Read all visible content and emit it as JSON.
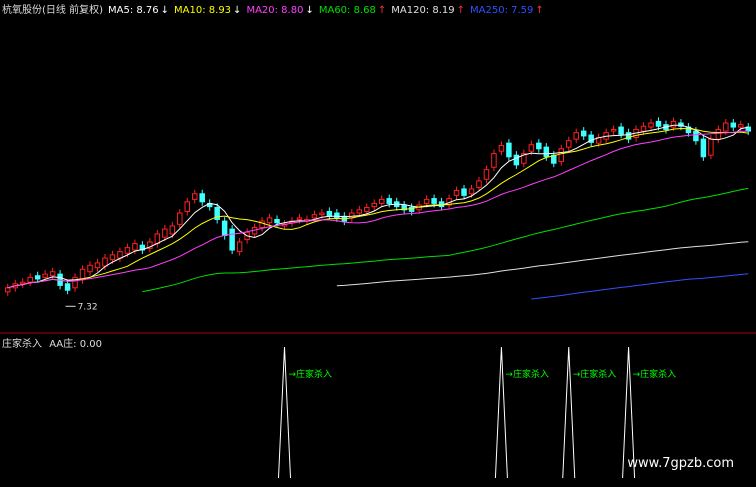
{
  "header": {
    "title": "杭氧股份(日线 前复权)",
    "indicators": [
      {
        "label": "MA5: 8.76",
        "arrow": "↓",
        "color": "#ffffff",
        "arrow_color": "#ffffff"
      },
      {
        "label": "MA10: 8.93",
        "arrow": "↓",
        "color": "#ffff00",
        "arrow_color": "#ffffff"
      },
      {
        "label": "MA20: 8.80",
        "arrow": "↓",
        "color": "#ff40ff",
        "arrow_color": "#ffffff"
      },
      {
        "label": "MA60: 8.68",
        "arrow": "↑",
        "color": "#00e000",
        "arrow_color": "#ff3030"
      },
      {
        "label": "MA120: 8.19",
        "arrow": "↑",
        "color": "#e0e0e0",
        "arrow_color": "#ff3030"
      },
      {
        "label": "MA250: 7.59",
        "arrow": "↑",
        "color": "#3050ff",
        "arrow_color": "#ff3030"
      }
    ]
  },
  "subpanel": {
    "title": "庄家杀入",
    "indicator": "AA庄: 0.00",
    "signal_label": "庄家杀入"
  },
  "annotations": {
    "low_marker": "7.32"
  },
  "watermark": "www.7gpzb.com",
  "colors": {
    "up": "#ff2020",
    "down": "#40ffff",
    "ma5": "#ffffff",
    "ma10": "#ffff00",
    "ma20": "#ff40ff",
    "ma60": "#00e000",
    "ma120": "#e0e0e0",
    "ma250": "#3050ff",
    "signal": "#ffffff",
    "signal_text": "#00ff00",
    "divider": "#b00000"
  },
  "chart_data": [
    {
      "type": "candlestick",
      "title": "杭氧股份(日线 前复权)",
      "ylim": [
        7.0,
        9.7
      ],
      "x": [
        1,
        2,
        3,
        4,
        5,
        6,
        7,
        8,
        9,
        10,
        11,
        12,
        13,
        14,
        15,
        16,
        17,
        18,
        19,
        20,
        21,
        22,
        23,
        24,
        25,
        26,
        27,
        28,
        29,
        30,
        31,
        32,
        33,
        34,
        35,
        36,
        37,
        38,
        39,
        40,
        41,
        42,
        43,
        44,
        45,
        46,
        47,
        48,
        49,
        50,
        51,
        52,
        53,
        54,
        55,
        56,
        57,
        58,
        59,
        60,
        61,
        62,
        63,
        64,
        65,
        66,
        67,
        68,
        69,
        70,
        71,
        72,
        73,
        74,
        75,
        76,
        77,
        78,
        79,
        80,
        81,
        82,
        83,
        84,
        85,
        86,
        87,
        88,
        89,
        90,
        91,
        92,
        93,
        94,
        95,
        96,
        97,
        98,
        99,
        100
      ],
      "open": [
        7.5,
        7.55,
        7.6,
        7.62,
        7.7,
        7.68,
        7.7,
        7.72,
        7.6,
        7.55,
        7.65,
        7.75,
        7.8,
        7.82,
        7.9,
        7.92,
        7.98,
        8.02,
        8.08,
        8.04,
        8.1,
        8.18,
        8.22,
        8.34,
        8.5,
        8.65,
        8.72,
        8.6,
        8.55,
        8.38,
        8.28,
        8.0,
        8.15,
        8.22,
        8.3,
        8.36,
        8.4,
        8.32,
        8.36,
        8.4,
        8.38,
        8.42,
        8.46,
        8.5,
        8.48,
        8.44,
        8.42,
        8.48,
        8.5,
        8.56,
        8.6,
        8.66,
        8.62,
        8.58,
        8.55,
        8.52,
        8.6,
        8.66,
        8.62,
        8.58,
        8.7,
        8.78,
        8.72,
        8.8,
        8.9,
        9.05,
        9.25,
        9.35,
        9.2,
        9.1,
        9.25,
        9.35,
        9.3,
        9.2,
        9.12,
        9.3,
        9.4,
        9.5,
        9.45,
        9.35,
        9.4,
        9.5,
        9.55,
        9.48,
        9.42,
        9.5,
        9.55,
        9.62,
        9.58,
        9.55,
        9.6,
        9.55,
        9.5,
        9.4,
        9.2,
        9.4,
        9.5,
        9.6,
        9.55,
        9.55
      ],
      "close": [
        7.55,
        7.6,
        7.62,
        7.68,
        7.66,
        7.72,
        7.75,
        7.58,
        7.52,
        7.68,
        7.78,
        7.83,
        7.86,
        7.92,
        7.96,
        8.0,
        8.05,
        8.1,
        8.02,
        8.12,
        8.22,
        8.28,
        8.32,
        8.48,
        8.62,
        8.72,
        8.62,
        8.56,
        8.4,
        8.2,
        8.02,
        8.12,
        8.24,
        8.3,
        8.38,
        8.42,
        8.36,
        8.34,
        8.38,
        8.42,
        8.4,
        8.46,
        8.48,
        8.44,
        8.42,
        8.38,
        8.48,
        8.52,
        8.55,
        8.6,
        8.65,
        8.6,
        8.56,
        8.52,
        8.5,
        8.58,
        8.65,
        8.6,
        8.56,
        8.66,
        8.76,
        8.7,
        8.78,
        8.88,
        9.02,
        9.22,
        9.32,
        9.18,
        9.08,
        9.22,
        9.33,
        9.28,
        9.18,
        9.1,
        9.28,
        9.38,
        9.48,
        9.44,
        9.36,
        9.42,
        9.48,
        9.52,
        9.46,
        9.4,
        9.52,
        9.56,
        9.6,
        9.56,
        9.52,
        9.62,
        9.56,
        9.48,
        9.38,
        9.18,
        9.4,
        9.52,
        9.6,
        9.55,
        9.58,
        9.5
      ],
      "marker": {
        "label": "7.32",
        "value": 7.32
      }
    },
    {
      "type": "line",
      "title": "庄家杀入",
      "series": [
        {
          "name": "AA庄",
          "signal_days": [
            38,
            67,
            76,
            84
          ]
        }
      ],
      "ylim": [
        0,
        1
      ],
      "annotations": [
        "庄家杀入",
        "庄家杀入",
        "庄家杀入",
        "庄家杀入"
      ]
    }
  ]
}
